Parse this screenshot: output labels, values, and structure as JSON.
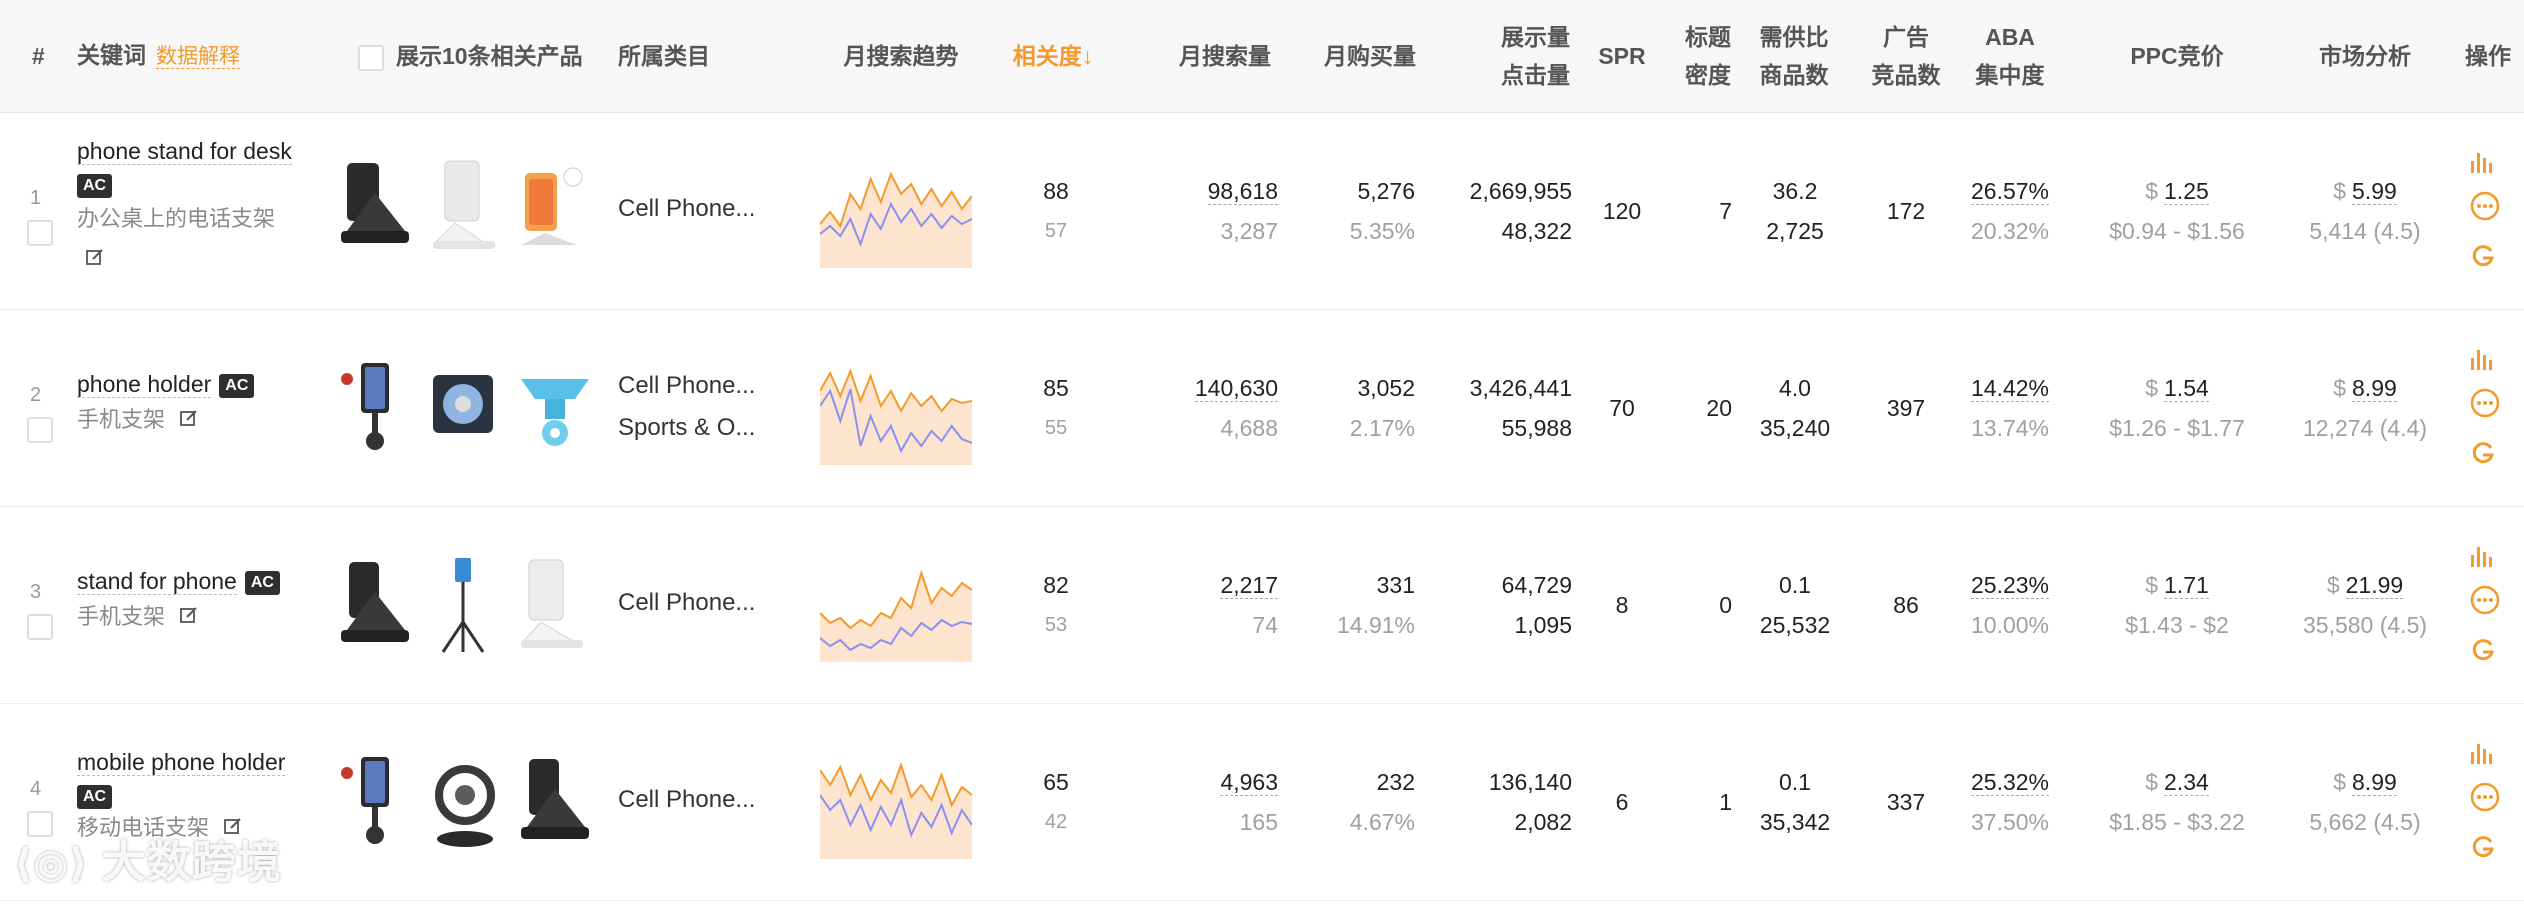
{
  "header": {
    "index": "#",
    "keyword": "关键词",
    "explain": "数据解释",
    "show_products": "展示10条相关产品",
    "category": "所属类目",
    "trend": "月搜索趋势",
    "relevance": "相关度↓",
    "monthly_search": "月搜索量",
    "monthly_purchase": "月购买量",
    "impressions_1": "展示量",
    "impressions_2": "点击量",
    "spr": "SPR",
    "title_density_1": "标题",
    "title_density_2": "密度",
    "supply_1": "需供比",
    "supply_2": "商品数",
    "ads_1": "广告",
    "ads_2": "竞品数",
    "aba_1": "ABA",
    "aba_2": "集中度",
    "ppc": "PPC竞价",
    "market": "市场分析",
    "ops": "操作"
  },
  "rows": [
    {
      "index": "1",
      "keyword": "phone stand for desk",
      "ac": "AC",
      "cn": "办公桌上的电话支架",
      "categories": [
        "Cell Phone..."
      ],
      "relevance": "88",
      "relevance_sub": "57",
      "search": "98,618",
      "search_sub": "3,287",
      "purchase": "5,276",
      "purchase_sub": "5.35%",
      "impressions": "2,669,955",
      "clicks": "48,322",
      "spr": "120",
      "density": "7",
      "supply_ratio": "36.2",
      "products": "2,725",
      "ads": "172",
      "aba": "26.57%",
      "aba_sub": "20.32%",
      "ppc": "1.25",
      "ppc_range": "$0.94 - $1.56",
      "market": "5.99",
      "market_sub": "5,414 (4.5)",
      "trend_orange": [
        40,
        52,
        38,
        70,
        55,
        85,
        62,
        90,
        70,
        80,
        60,
        75,
        58,
        72,
        55,
        68
      ],
      "trend_blue": [
        30,
        38,
        28,
        45,
        20,
        50,
        35,
        60,
        42,
        55,
        38,
        50,
        36,
        48,
        40,
        45
      ]
    },
    {
      "index": "2",
      "keyword": "phone holder",
      "ac": "AC",
      "cn": "手机支架",
      "categories": [
        "Cell Phone...",
        "Sports & O..."
      ],
      "relevance": "85",
      "relevance_sub": "55",
      "search": "140,630",
      "search_sub": "4,688",
      "purchase": "3,052",
      "purchase_sub": "2.17%",
      "impressions": "3,426,441",
      "clicks": "55,988",
      "spr": "70",
      "density": "20",
      "supply_ratio": "4.0",
      "products": "35,240",
      "ads": "397",
      "aba": "14.42%",
      "aba_sub": "13.74%",
      "ppc": "1.54",
      "ppc_range": "$1.26 - $1.77",
      "market": "8.99",
      "market_sub": "12,274 (4.4)",
      "trend_orange": [
        70,
        88,
        65,
        90,
        60,
        85,
        55,
        70,
        50,
        68,
        55,
        65,
        50,
        62,
        58,
        60
      ],
      "trend_blue": [
        55,
        70,
        40,
        72,
        15,
        45,
        20,
        35,
        10,
        28,
        15,
        30,
        20,
        35,
        22,
        18
      ]
    },
    {
      "index": "3",
      "keyword": "stand for phone",
      "ac": "AC",
      "cn": "手机支架",
      "categories": [
        "Cell Phone..."
      ],
      "relevance": "82",
      "relevance_sub": "53",
      "search": "2,217",
      "search_sub": "74",
      "purchase": "331",
      "purchase_sub": "14.91%",
      "impressions": "64,729",
      "clicks": "1,095",
      "spr": "8",
      "density": "0",
      "supply_ratio": "0.1",
      "products": "25,532",
      "ads": "86",
      "aba": "25.23%",
      "aba_sub": "10.00%",
      "ppc": "1.71",
      "ppc_range": "$1.43 - $2",
      "market": "21.99",
      "market_sub": "35,580 (4.5)",
      "trend_orange": [
        45,
        35,
        40,
        30,
        38,
        32,
        45,
        40,
        60,
        50,
        85,
        55,
        70,
        62,
        75,
        68
      ],
      "trend_blue": [
        20,
        12,
        18,
        8,
        14,
        10,
        18,
        14,
        30,
        22,
        35,
        28,
        38,
        32,
        36,
        34
      ]
    },
    {
      "index": "4",
      "keyword": "mobile phone holder",
      "ac": "AC",
      "cn": "移动电话支架",
      "categories": [
        "Cell Phone..."
      ],
      "relevance": "65",
      "relevance_sub": "42",
      "search": "4,963",
      "search_sub": "165",
      "purchase": "232",
      "purchase_sub": "4.67%",
      "impressions": "136,140",
      "clicks": "2,082",
      "spr": "6",
      "density": "1",
      "supply_ratio": "0.1",
      "products": "35,342",
      "ads": "337",
      "aba": "25.32%",
      "aba_sub": "37.50%",
      "ppc": "2.34",
      "ppc_range": "$1.85 - $3.22",
      "market": "8.99",
      "market_sub": "5,662 (4.5)",
      "trend_orange": [
        85,
        70,
        88,
        60,
        80,
        55,
        75,
        62,
        90,
        58,
        70,
        55,
        80,
        50,
        68,
        60
      ],
      "trend_blue": [
        60,
        45,
        55,
        30,
        50,
        25,
        48,
        30,
        55,
        20,
        42,
        28,
        50,
        22,
        45,
        30
      ]
    }
  ],
  "watermark": "大数跨境",
  "colors": {
    "accent": "#f39a2b",
    "trend_blue": "#8c8ff0",
    "trend_fill": "#fde4cf"
  }
}
